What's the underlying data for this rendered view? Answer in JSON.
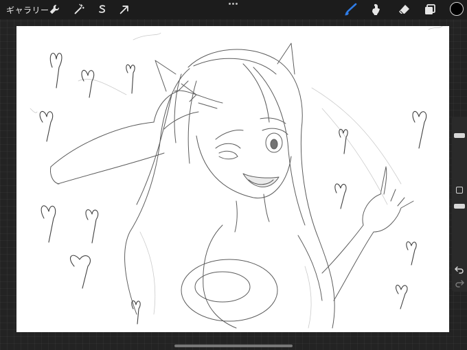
{
  "topbar": {
    "gallery_label": "ギャラリー",
    "tools_left": [
      "wrench-icon",
      "magic-wand-icon",
      "selection-icon",
      "transform-arrow-icon"
    ],
    "tools_right": [
      "brush-icon",
      "smudge-icon",
      "eraser-icon",
      "layers-icon"
    ],
    "current_color": "#000000",
    "accent_color": "#2f7ce6"
  },
  "sidebar": {
    "brush_size_level": 0.15,
    "opacity_level": 0.55
  }
}
